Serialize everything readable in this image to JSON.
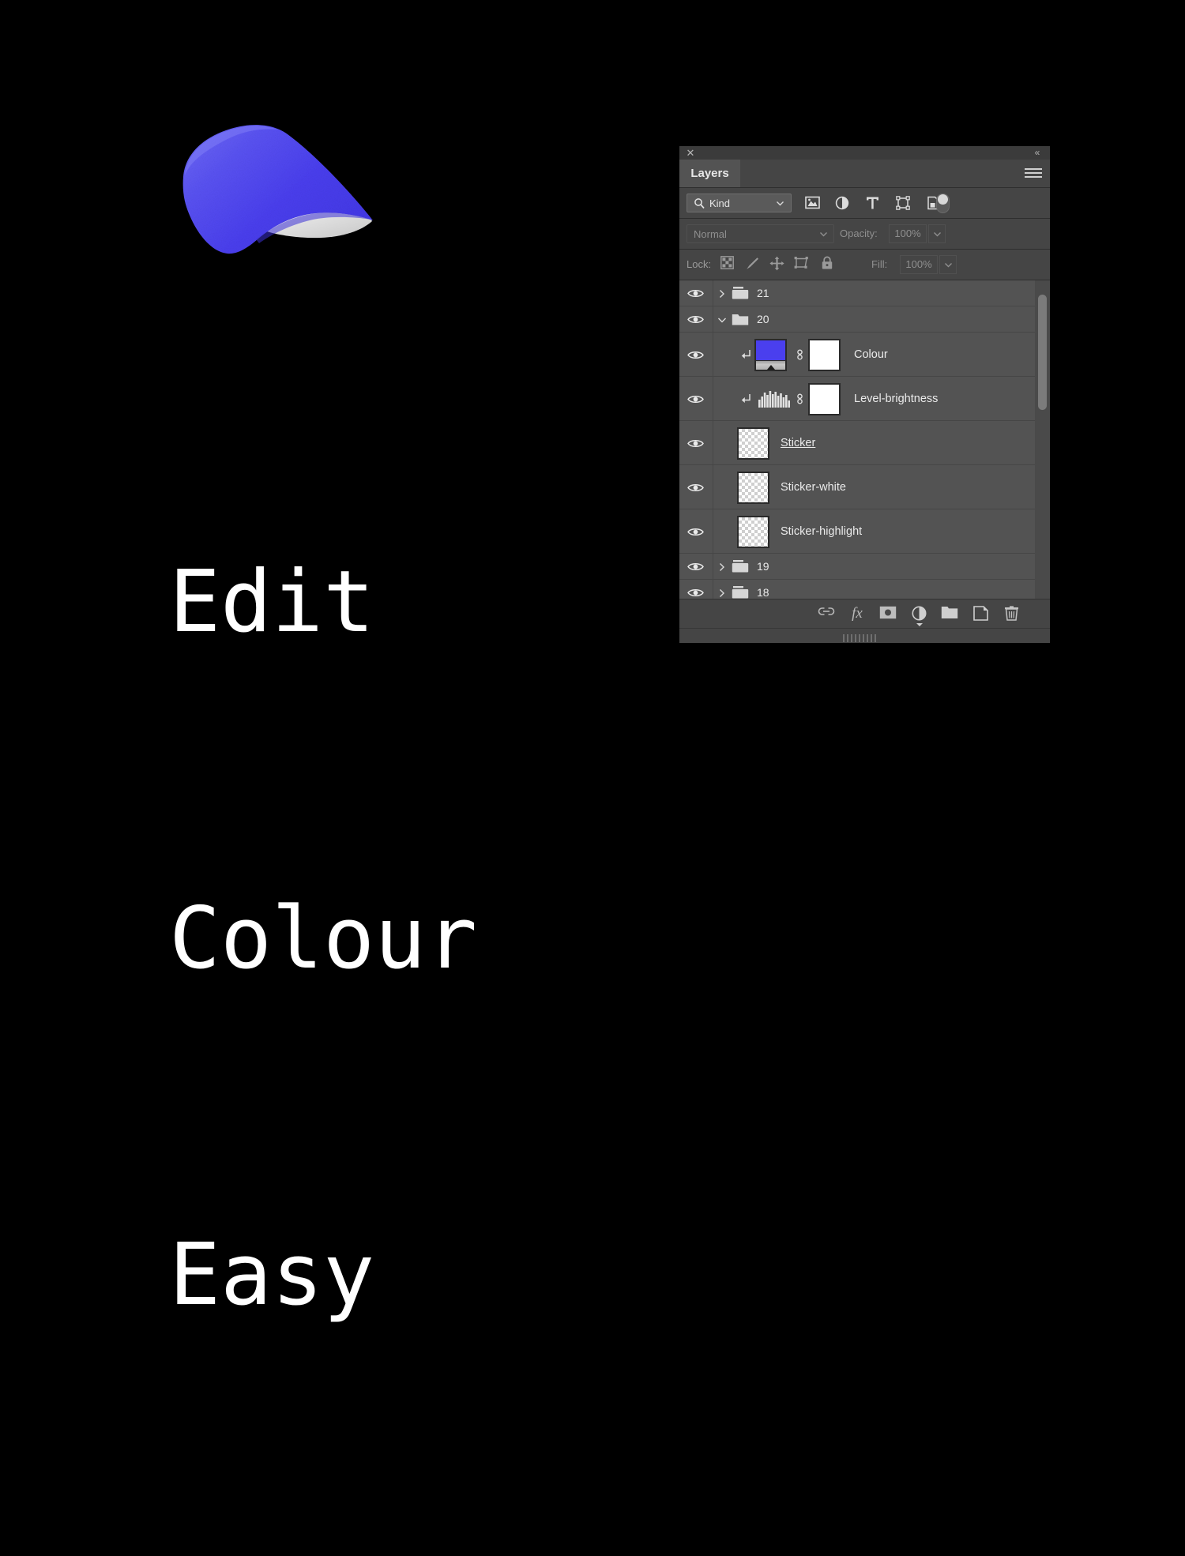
{
  "hero": {
    "lines": [
      "Edit",
      "Colour",
      "Easy"
    ],
    "text_color": "#ffffff",
    "background": "#000000"
  },
  "artwork": {
    "name": "peeling-sticker-mockup",
    "sticker_color": "#4a3fee",
    "backing_color": "#e9e9e9"
  },
  "panel": {
    "titlebar": {
      "close_icon": "close-icon",
      "collapse_icon": "collapse-to-icons-icon",
      "collapse_glyph": "«",
      "close_glyph": "✕"
    },
    "tab": {
      "label": "Layers"
    },
    "menu_button": {
      "name": "panel-menu-icon"
    },
    "filter": {
      "kind_label": "Kind",
      "search_icon": "search-icon",
      "chevron_icon": "chevron-down-icon",
      "icons": [
        {
          "name": "filter-pixel-icon",
          "title": "Pixel layers"
        },
        {
          "name": "filter-adjustment-icon",
          "title": "Adjustment layers"
        },
        {
          "name": "filter-type-icon",
          "title": "Type layers"
        },
        {
          "name": "filter-shape-icon",
          "title": "Shape layers"
        },
        {
          "name": "filter-smart-object-icon",
          "title": "Smart objects"
        }
      ],
      "toggle": {
        "name": "filter-enable-toggle",
        "state": "on"
      }
    },
    "blend": {
      "mode": "Normal",
      "opacity_label": "Opacity:",
      "opacity_value": "100%"
    },
    "lock": {
      "label": "Lock:",
      "icons": [
        {
          "name": "lock-transparent-pixels-icon"
        },
        {
          "name": "lock-image-pixels-icon"
        },
        {
          "name": "lock-position-icon"
        },
        {
          "name": "lock-artboard-nesting-icon"
        },
        {
          "name": "lock-all-icon"
        }
      ],
      "fill_label": "Fill:",
      "fill_value": "100%"
    },
    "layers": [
      {
        "type": "group",
        "name": "21",
        "visible": true,
        "expanded": false
      },
      {
        "type": "group",
        "name": "20",
        "visible": true,
        "expanded": true
      },
      {
        "type": "adjustment",
        "name": "Colour",
        "visible": true,
        "clipped": true,
        "thumb": "solid-color",
        "mask": "white",
        "linked": true,
        "selected": false
      },
      {
        "type": "adjustment",
        "name": "Level-brightness",
        "visible": true,
        "clipped": true,
        "thumb": "histogram",
        "mask": "white",
        "linked": true,
        "selected": false
      },
      {
        "type": "pixel",
        "name": "Sticker ",
        "visible": true,
        "thumb": "transparent",
        "underlined": true
      },
      {
        "type": "pixel",
        "name": "Sticker-white",
        "visible": true,
        "thumb": "transparent",
        "underlined": false
      },
      {
        "type": "pixel",
        "name": "Sticker-highlight",
        "visible": true,
        "thumb": "transparent",
        "underlined": false
      },
      {
        "type": "group",
        "name": "19",
        "visible": true,
        "expanded": false
      },
      {
        "type": "group",
        "name": "18",
        "visible": true,
        "expanded": false
      }
    ],
    "scrollbar": {
      "name": "layer-list-scrollbar"
    },
    "bottom_toolbar": [
      {
        "name": "link-layers-icon",
        "title": "Link layers"
      },
      {
        "name": "layer-style-fx-icon",
        "title": "Add a layer style",
        "label": "fx"
      },
      {
        "name": "add-layer-mask-icon",
        "title": "Add layer mask"
      },
      {
        "name": "new-adjustment-layer-icon",
        "title": "Create new fill or adjustment layer"
      },
      {
        "name": "new-group-icon",
        "title": "Create a new group"
      },
      {
        "name": "new-layer-icon",
        "title": "Create a new layer"
      },
      {
        "name": "delete-layer-icon",
        "title": "Delete layer"
      }
    ],
    "statusbar": {
      "grip": "resize-grip"
    }
  },
  "colors": {
    "panel_bg": "#454545",
    "list_bg": "#535353",
    "tab_bg": "#535353",
    "accent_blue": "#4a3fee",
    "text": "#e9e9e9",
    "text_dim": "#8f8f8f"
  }
}
